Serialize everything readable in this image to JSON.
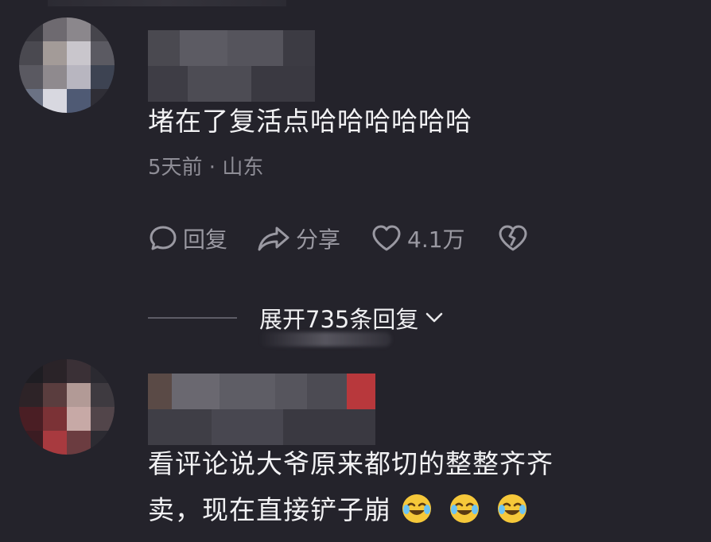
{
  "comments": [
    {
      "text": "堵在了复活点哈哈哈哈哈哈",
      "time_location": "5天前 · 山东",
      "actions": {
        "reply_label": "回复",
        "share_label": "分享",
        "like_count": "4.1万"
      },
      "expand_label": "展开735条回复"
    },
    {
      "text_line1": "看评论说大爷原来都切的整整齐齐",
      "text_line2": "卖，现在直接铲子崩"
    }
  ],
  "icons": {
    "reply": "speech-bubble-icon",
    "share": "share-arrow-icon",
    "like": "heart-icon",
    "dislike": "broken-heart-icon",
    "expand": "chevron-down-icon",
    "emoji": "laughing-crying-emoji"
  },
  "colors": {
    "background": "#24232b",
    "text_primary": "#f2f2f4",
    "text_secondary": "#8e8d96",
    "emoji_yellow": "#f6c83a"
  }
}
